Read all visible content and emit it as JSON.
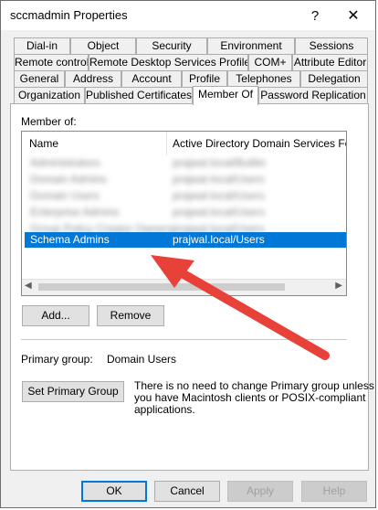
{
  "window": {
    "title": "sccmadmin Properties",
    "help_glyph": "?",
    "close_glyph": "✕"
  },
  "tabs": {
    "row1": [
      "Dial-in",
      "Object",
      "Security",
      "Environment",
      "Sessions"
    ],
    "row2": [
      "Remote control",
      "Remote Desktop Services Profile",
      "COM+",
      "Attribute Editor"
    ],
    "row3": [
      "General",
      "Address",
      "Account",
      "Profile",
      "Telephones",
      "Delegation"
    ],
    "row4": [
      "Organization",
      "Published Certificates",
      "Member Of",
      "Password Replication"
    ],
    "active": "Member Of"
  },
  "member_of": {
    "label": "Member of:",
    "columns": [
      "Name",
      "Active Directory Domain Services Folder"
    ],
    "rows": [
      {
        "name": "Administrators",
        "folder": "prajwal.local/Builtin",
        "blurred": true
      },
      {
        "name": "Domain Admins",
        "folder": "prajwal.local/Users",
        "blurred": true
      },
      {
        "name": "Domain Users",
        "folder": "prajwal.local/Users",
        "blurred": true
      },
      {
        "name": "Enterprise Admins",
        "folder": "prajwal.local/Users",
        "blurred": true
      },
      {
        "name": "Group Policy Creator Owners",
        "folder": "prajwal.local/Users",
        "blurred": true
      },
      {
        "name": "Schema Admins",
        "folder": "prajwal.local/Users",
        "selected": true
      }
    ]
  },
  "buttons": {
    "add": "Add...",
    "remove": "Remove",
    "set_primary": "Set Primary Group",
    "ok": "OK",
    "cancel": "Cancel",
    "apply": "Apply",
    "help": "Help"
  },
  "primary_group": {
    "label": "Primary group:",
    "value": "Domain Users",
    "note_line1": "There is no need to change Primary group unless",
    "note_line2": "you have Macintosh clients or POSIX-compliant",
    "note_line3": "applications."
  },
  "scrollbar": {
    "left_glyph": "◀",
    "right_glyph": "▶"
  },
  "colors": {
    "selection": "#0078d7",
    "annotation_arrow": "#e8413a"
  }
}
